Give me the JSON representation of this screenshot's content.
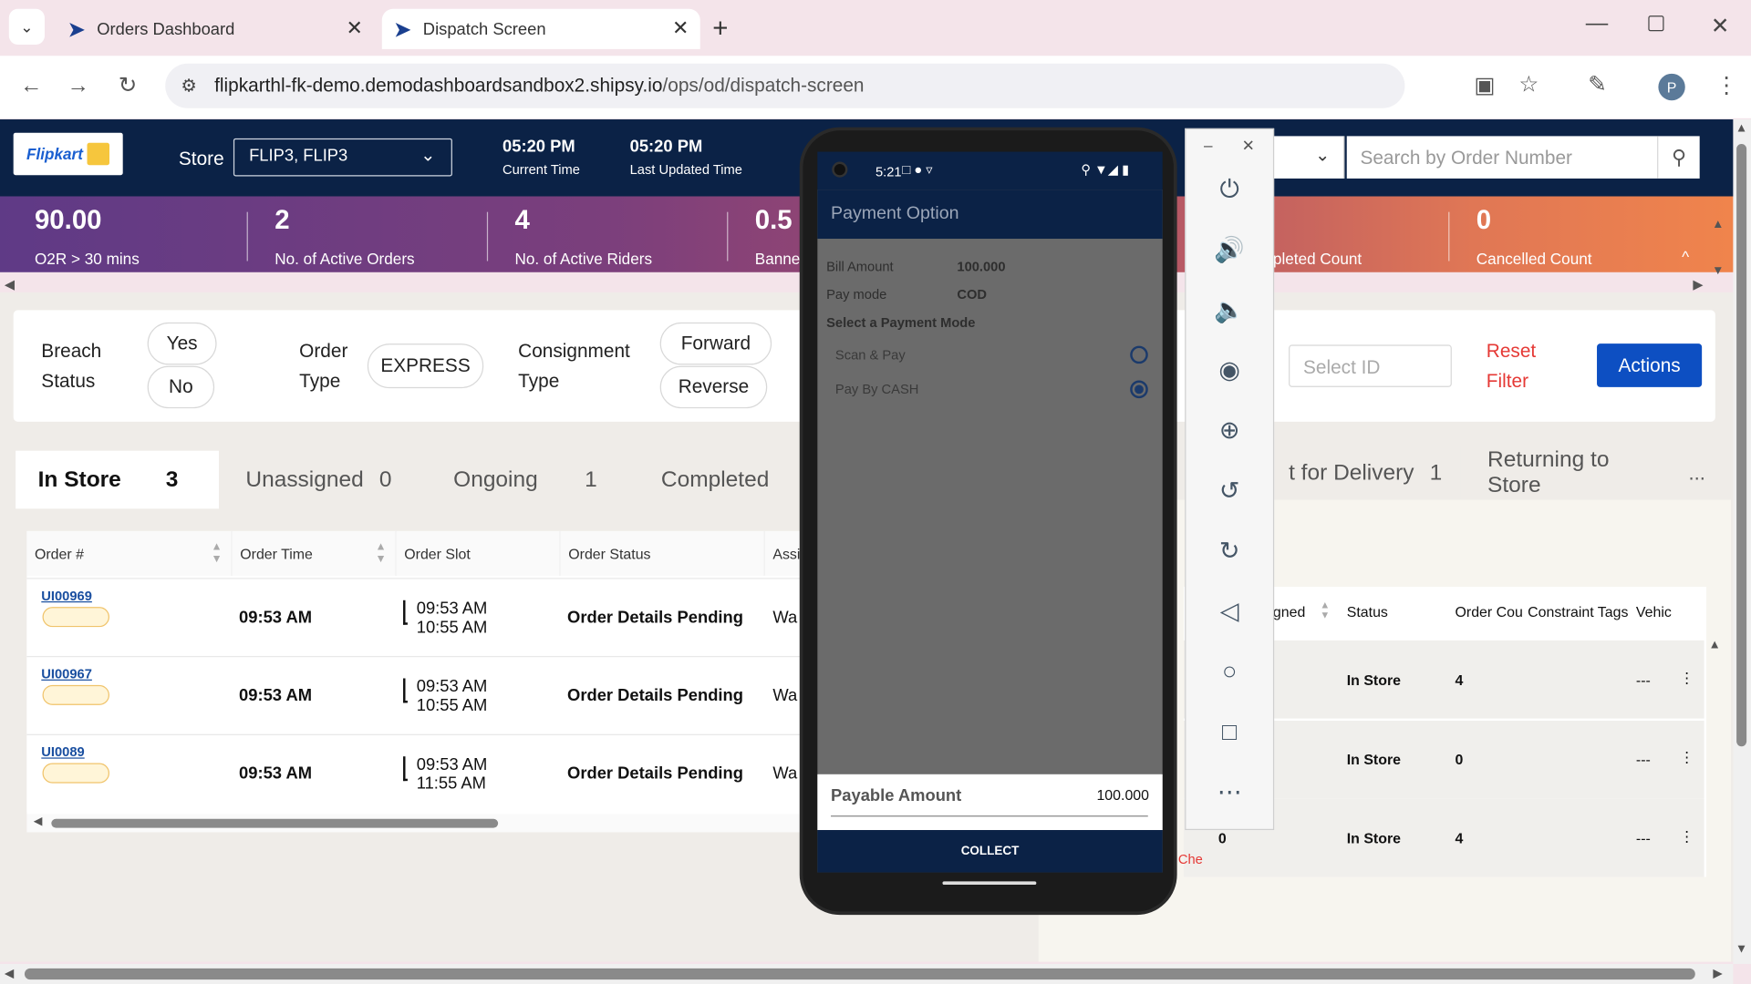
{
  "browser": {
    "tabs": [
      {
        "label": "Orders Dashboard"
      },
      {
        "label": "Dispatch Screen"
      }
    ],
    "url_host": "flipkarthl-fk-demo.demodashboardsandbox2.shipsy.io",
    "url_path": "/ops/od/dispatch-screen",
    "profile_initial": "P"
  },
  "header": {
    "logo": "Flipkart",
    "store_label": "Store",
    "store_value": "FLIP3, FLIP3",
    "current_time": "05:20 PM",
    "current_time_label": "Current Time",
    "last_updated": "05:20 PM",
    "last_updated_label": "Last Updated Time",
    "search_placeholder": "Search by Order Number"
  },
  "metrics": [
    {
      "value": "90.00",
      "label": "O2R > 30 mins"
    },
    {
      "value": "2",
      "label": "No. of Active Orders"
    },
    {
      "value": "4",
      "label": "No. of Active Riders"
    },
    {
      "value": "0.5",
      "label": "Banne"
    },
    {
      "value": "",
      "label": "pleted Count"
    },
    {
      "value": "0",
      "label": "Cancelled Count"
    }
  ],
  "filters": {
    "breach_label_1": "Breach",
    "breach_label_2": "Status",
    "breach_yes": "Yes",
    "breach_no": "No",
    "order_type_1": "Order",
    "order_type_2": "Type",
    "order_type_value": "EXPRESS",
    "consignment_1": "Consignment",
    "consignment_2": "Type",
    "forward": "Forward",
    "reverse": "Reverse",
    "select_id_placeholder": "Select ID",
    "reset_1": "Reset",
    "reset_2": "Filter",
    "actions": "Actions"
  },
  "status_tabs": [
    {
      "label": "In Store",
      "count": "3"
    },
    {
      "label": "Unassigned",
      "count": "0"
    },
    {
      "label": "Ongoing",
      "count": "1"
    },
    {
      "label": "Completed",
      "count": ""
    }
  ],
  "right_tabs": [
    {
      "label": "t for Delivery",
      "count": "1"
    },
    {
      "label": "Returning to Store",
      "count": ""
    }
  ],
  "more": "...",
  "table": {
    "headers": [
      "Order #",
      "Order Time",
      "Order Slot",
      "Order Status",
      "Assi"
    ],
    "rows": [
      {
        "order": "UI00969",
        "time": "09:53 AM",
        "slot_start": "09:53 AM",
        "slot_end": "10:55 AM",
        "status": "Order Details Pending",
        "assigned": "Wa"
      },
      {
        "order": "UI00967",
        "time": "09:53 AM",
        "slot_start": "09:53 AM",
        "slot_end": "10:55 AM",
        "status": "Order Details Pending",
        "assigned": "Wa"
      },
      {
        "order": "UI0089",
        "time": "09:53 AM",
        "slot_start": "09:53 AM",
        "slot_end": "11:55 AM",
        "status": "Order Details Pending",
        "assigned": "Wa"
      }
    ]
  },
  "rider_table": {
    "headers": [
      "gned",
      "Status",
      "Order Cou",
      "Constraint Tags",
      "Vehic"
    ],
    "rows": [
      {
        "status": "In Store",
        "count": "4",
        "tags": "---"
      },
      {
        "status": "In Store",
        "count": "0",
        "tags": "---"
      },
      {
        "status": "In Store",
        "count": "4",
        "tags": "---"
      }
    ],
    "partial_zero": "0",
    "partial_text": "Che"
  },
  "phone": {
    "clock": "5:21",
    "title": "Payment Option",
    "bill_amount_label": "Bill Amount",
    "bill_amount": "100.000",
    "pay_mode_label": "Pay mode",
    "pay_mode": "COD",
    "select_mode": "Select a Payment Mode",
    "option_1": "Scan & Pay",
    "option_2": "Pay By CASH",
    "payable_label": "Payable Amount",
    "payable_value": "100.000",
    "collect": "COLLECT"
  },
  "colors": {
    "header_bg": "#0b2246",
    "accent_blue": "#0d4fc2",
    "reset_red": "#e53935",
    "phone_title": "#0b2246"
  }
}
